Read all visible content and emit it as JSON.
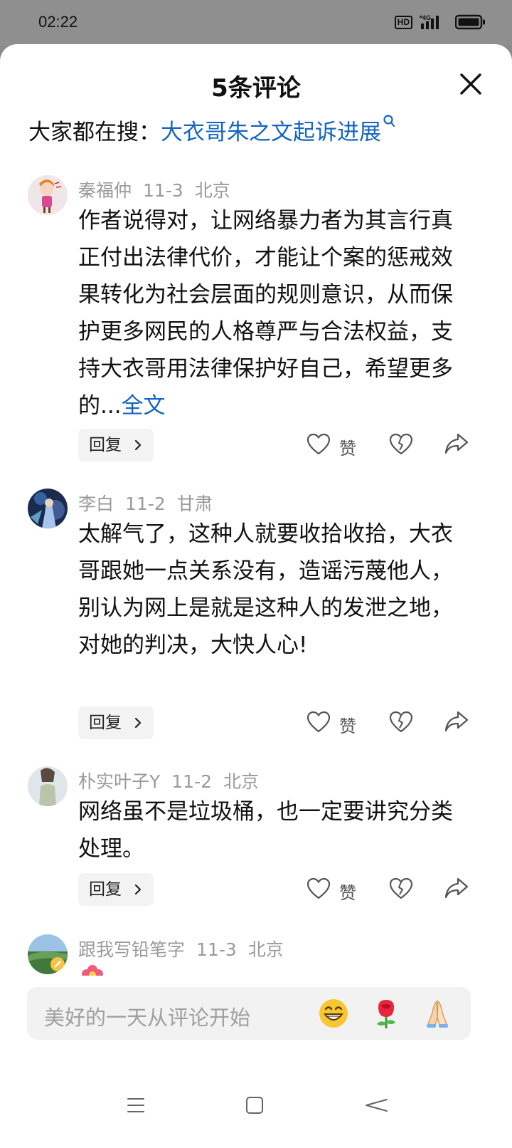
{
  "status": {
    "time": "02:22",
    "hd": "HD",
    "network": "4G"
  },
  "header": {
    "title": "5条评论"
  },
  "hot_search": {
    "prefix": "大家都在搜：",
    "query": "大衣哥朱之文起诉进展"
  },
  "comments": [
    {
      "user": "秦福仲",
      "date": "11-3",
      "location": "北京",
      "text": "作者说得对，让网络暴力者为其言行真正付出法律代价，才能让个案的惩戒效果转化为社会层面的规则意识，从而保护更多网民的人格尊严与合法权益，支持大衣哥用法律保护好自己，希望更多的...",
      "full_label": "全文",
      "reply_label": "回复",
      "like_label": "赞"
    },
    {
      "user": "李白",
      "date": "11-2",
      "location": "甘肃",
      "text": "太解气了，这种人就要收拾收拾，大衣哥跟她一点关系没有，造谣污蔑他人，别认为网上是就是这种人的发泄之地，对她的判决，大快人心!",
      "reply_label": "回复",
      "like_label": "赞"
    },
    {
      "user": "朴实叶子Y",
      "date": "11-2",
      "location": "北京",
      "text": "网络虽不是垃圾桶，也一定要讲究分类处理。",
      "reply_label": "回复",
      "like_label": "赞"
    },
    {
      "user": "跟我写铅笔字",
      "date": "11-3",
      "location": "北京"
    }
  ],
  "input": {
    "placeholder": "美好的一天从评论开始"
  },
  "emojis": [
    "grin-emoji",
    "rose-emoji",
    "pray-emoji"
  ],
  "colors": {
    "link": "#1565c0",
    "meta": "#9a9a9a",
    "status_bar": "#8f8f8f"
  }
}
